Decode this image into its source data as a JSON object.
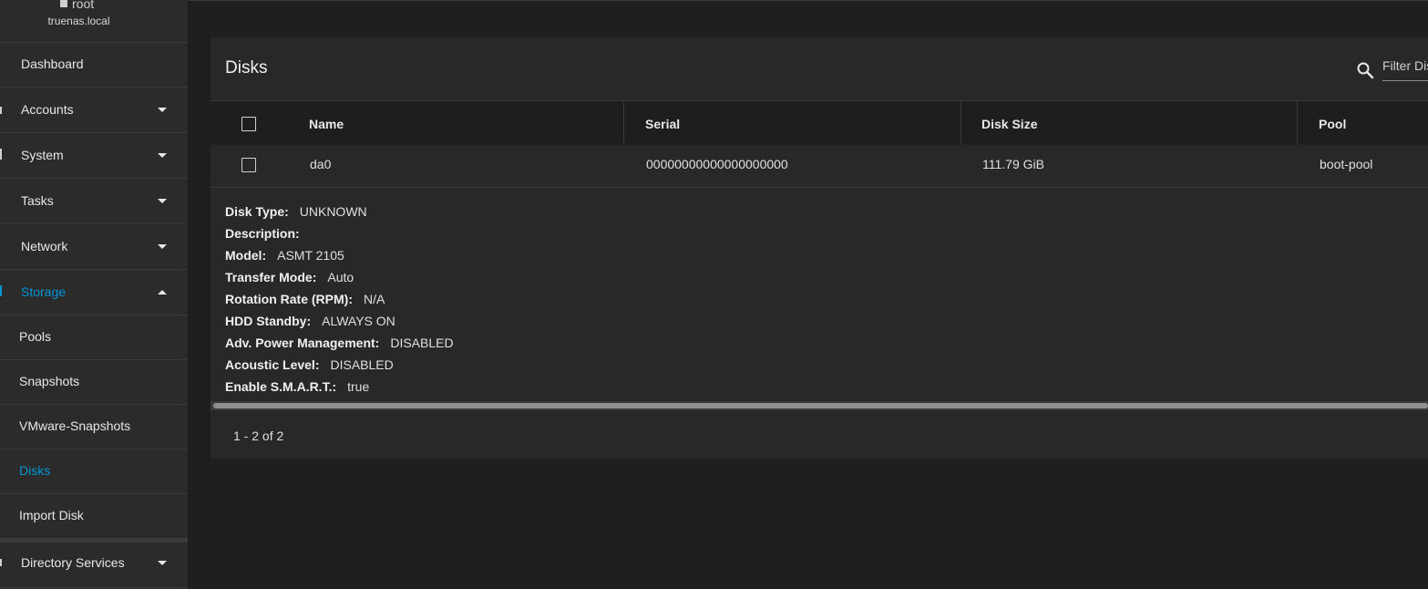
{
  "user": {
    "name": "root",
    "host": "truenas.local"
  },
  "nav": [
    {
      "label": "Dashboard",
      "caret": ""
    },
    {
      "label": "Accounts",
      "caret": "down"
    },
    {
      "label": "System",
      "caret": "down"
    },
    {
      "label": "Tasks",
      "caret": "down"
    },
    {
      "label": "Network",
      "caret": "down"
    },
    {
      "label": "Storage",
      "caret": "up"
    }
  ],
  "storage_sub": [
    "Pools",
    "Snapshots",
    "VMware-Snapshots",
    "Disks",
    "Import Disk"
  ],
  "nav_bottom": {
    "label": "Directory Services"
  },
  "card": {
    "title": "Disks",
    "filter_placeholder": "Filter Disks",
    "columns": [
      "Name",
      "Serial",
      "Disk Size",
      "Pool"
    ],
    "row": {
      "name": "da0",
      "serial": "00000000000000000000",
      "size": "111.79 GiB",
      "pool": "boot-pool"
    },
    "details": [
      {
        "k": "Disk Type:",
        "v": "UNKNOWN"
      },
      {
        "k": "Description:",
        "v": ""
      },
      {
        "k": "Model:",
        "v": "ASMT 2105"
      },
      {
        "k": "Transfer Mode:",
        "v": "Auto"
      },
      {
        "k": "Rotation Rate (RPM):",
        "v": "N/A"
      },
      {
        "k": "HDD Standby:",
        "v": "ALWAYS ON"
      },
      {
        "k": "Adv. Power Management:",
        "v": "DISABLED"
      },
      {
        "k": "Acoustic Level:",
        "v": "DISABLED"
      },
      {
        "k": "Enable S.M.A.R.T.:",
        "v": "true"
      }
    ],
    "pager": "1 - 2 of 2"
  },
  "colors": {
    "accent": "#0095d5",
    "bg": "#1f1f1f",
    "card": "#282828",
    "sidebar": "#2b2b2b"
  }
}
